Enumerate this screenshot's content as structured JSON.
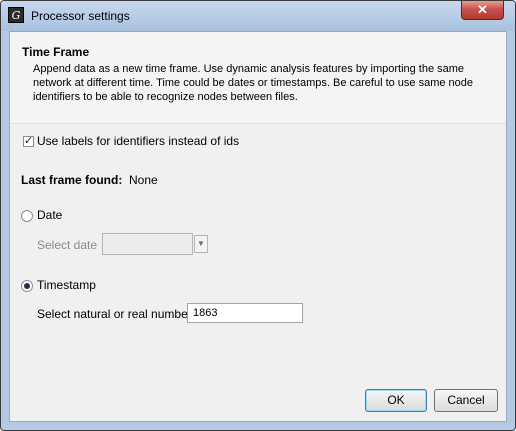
{
  "window": {
    "title": "Processor settings",
    "close_glyph": "✕",
    "app_icon": "gephi-app-icon",
    "app_icon_glyph": "G"
  },
  "header": {
    "title": "Time Frame",
    "description": "Append data as a new time frame. Use dynamic analysis features by importing the same network at different time. Time could be dates or timestamps. Be careful to use same node identifiers to be able to recognize nodes between files."
  },
  "options": {
    "use_labels": {
      "label": "Use labels for identifiers instead of ids",
      "checked": true
    },
    "last_frame": {
      "label": "Last frame found:",
      "value": "None"
    }
  },
  "date": {
    "radio_label": "Date",
    "selected": false,
    "select_label": "Select date",
    "value": ""
  },
  "timestamp": {
    "radio_label": "Timestamp",
    "selected": true,
    "select_label": "Select natural or real number",
    "value": "1863"
  },
  "buttons": {
    "ok": "OK",
    "cancel": "Cancel"
  },
  "colors": {
    "title_bar": "#b4c9e2",
    "close_button": "#c75050",
    "dialog_bg": "#f0f0f0"
  }
}
